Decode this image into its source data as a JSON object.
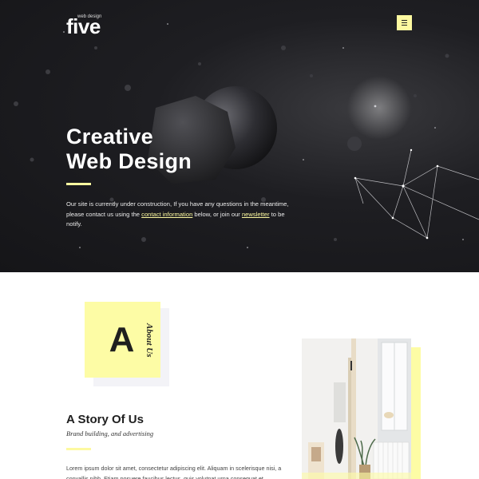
{
  "header": {
    "logo_tagline": "web design",
    "logo_name": "five",
    "menu_icon": "hamburger-icon"
  },
  "hero": {
    "title_line1": "Creative",
    "title_line2": "Web Design",
    "text_before": "Our site is currently under construction, If you have any questions in the meantime, please contact us using the ",
    "link_contact": "contact information",
    "text_middle": " below, or join our ",
    "link_newsletter": "newsletter",
    "text_after": " to be notify."
  },
  "about": {
    "badge_letter": "A",
    "badge_label": "About Us",
    "title": "A Story Of Us",
    "subtitle": "Brand building, and advertising",
    "body": "Lorem ipsum dolor sit amet, consectetur adipiscing elit. Aliquam in scelerisque nisi, a convallis nibh. Etiam posuere faucibus lectus, quis volutpat urna consequat et."
  },
  "colors": {
    "accent": "#fdf9a0",
    "hero_bg": "#1e1e22",
    "text_dark": "#1e1e1e"
  }
}
